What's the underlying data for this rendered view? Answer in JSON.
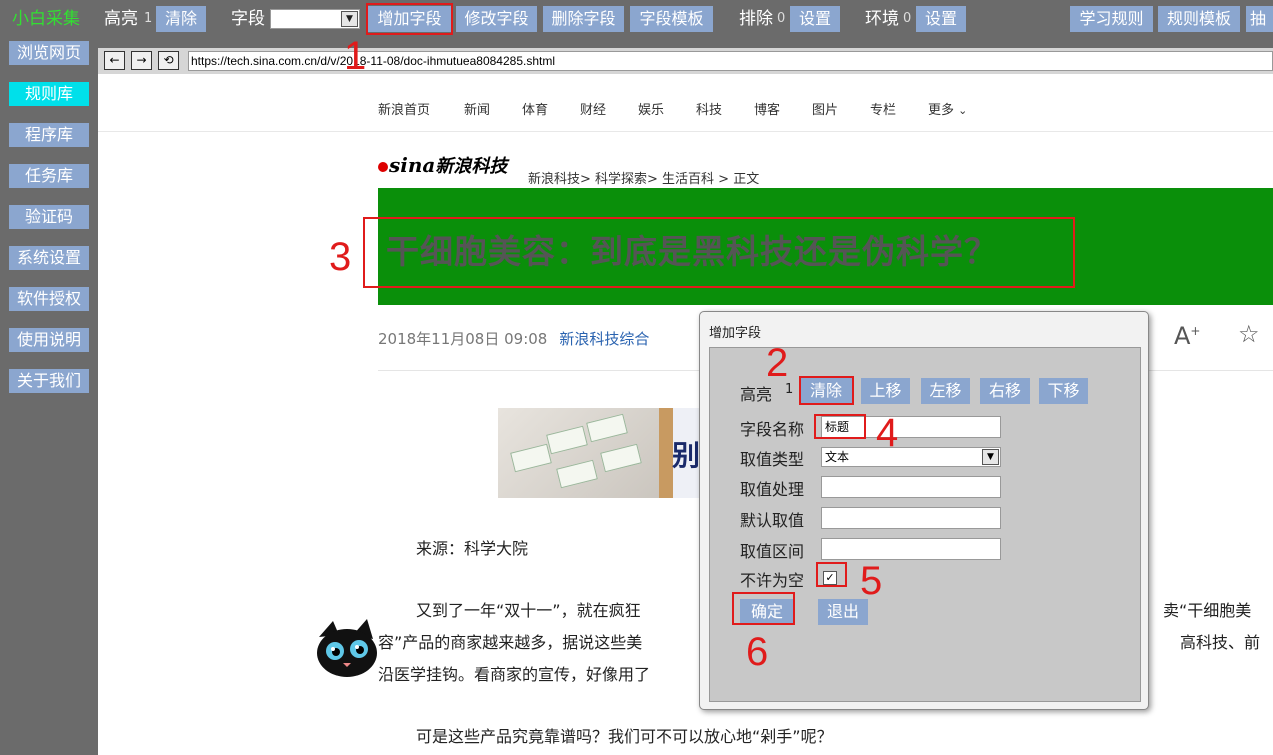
{
  "toolbar": {
    "brand": "小白采集",
    "highlight_label": "高亮",
    "highlight_count": "1",
    "clear_label": "清除",
    "field_label": "字段",
    "field_select_value": "",
    "add_field": "增加字段",
    "edit_field": "修改字段",
    "delete_field": "删除字段",
    "field_template": "字段模板",
    "exclude_label": "排除",
    "exclude_count": "0",
    "exclude_settings": "设置",
    "env_label": "环境",
    "env_count": "0",
    "env_settings": "设置",
    "learn_rules": "学习规则",
    "rule_template": "规则模板",
    "extract": "抽"
  },
  "sidebar": {
    "items": [
      {
        "label": "浏览网页"
      },
      {
        "label": "规则库"
      },
      {
        "label": "程序库"
      },
      {
        "label": "任务库"
      },
      {
        "label": "验证码"
      },
      {
        "label": "系统设置"
      },
      {
        "label": "软件授权"
      },
      {
        "label": "使用说明"
      },
      {
        "label": "关于我们"
      }
    ],
    "active_color": "#00e0ea"
  },
  "browser": {
    "back": "←",
    "forward": "→",
    "refresh": "⟲",
    "url": "https://tech.sina.com.cn/d/v/2018-11-08/doc-ihmutuea8084285.shtml"
  },
  "web": {
    "nav": [
      "新浪首页",
      "新闻",
      "体育",
      "财经",
      "娱乐",
      "科技",
      "博客",
      "图片",
      "专栏",
      "更多"
    ],
    "logo_text": "sina",
    "logo_cn": "新浪科技",
    "breadcrumb": "新浪科技> 科学探索> 生活百科 > 正文",
    "title": "干细胞美容：到底是黑科技还是伪科学？",
    "title_bg": "#0a8f0a",
    "date": "2018年11月08日 09:08",
    "source": "新浪科技综合",
    "ad_text": "别",
    "para1": "来源：科学大院",
    "para2a": "又到了一年“双十一”，就在疯狂",
    "para2b": "卖“干细胞美",
    "para3a": "容”产品的商家越来越多，据说这些美",
    "para3b": "高科技、前",
    "para4": "沿医学挂钩。看商家的宣传，好像用了",
    "para5": "可是这些产品究竟靠谱吗？我们可不可以放心地“剁手”呢？"
  },
  "dialog": {
    "title": "增加字段",
    "highlight_label": "高亮",
    "highlight_count": "1",
    "clear": "清除",
    "move_up": "上移",
    "move_left": "左移",
    "move_right": "右移",
    "move_down": "下移",
    "field_name_label": "字段名称",
    "field_name_value": "标题",
    "value_type_label": "取值类型",
    "value_type_value": "文本",
    "value_process_label": "取值处理",
    "value_process_value": "",
    "default_value_label": "默认取值",
    "default_value_value": "",
    "value_range_label": "取值区间",
    "value_range_value": "",
    "not_null_label": "不许为空",
    "not_null_checked": true,
    "confirm": "确定",
    "exit": "退出"
  },
  "annotations": [
    "1",
    "2",
    "3",
    "4",
    "5",
    "6"
  ],
  "colors": {
    "toolbar_bg": "#6b6b6b",
    "button_bg": "#8ba6cf",
    "brand": "#32e032",
    "annotation_red": "#e01b1b"
  }
}
